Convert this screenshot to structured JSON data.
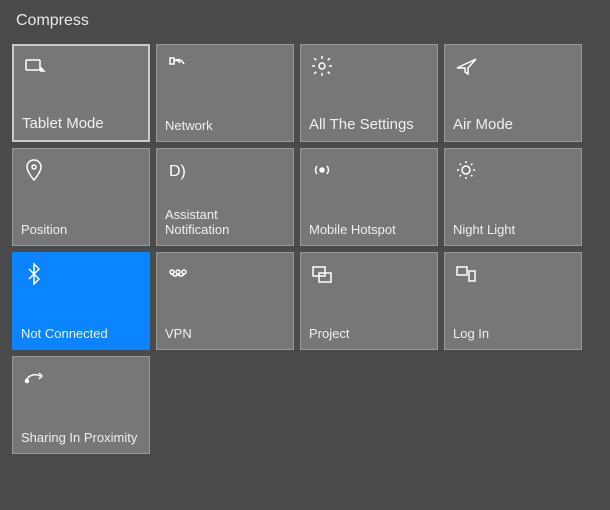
{
  "header": "Compress",
  "tiles": [
    {
      "icon": "tablet-mode-icon",
      "label": "Tablet Mode",
      "sublabel": "",
      "active": false
    },
    {
      "icon": "wifi-icon",
      "label": "Network",
      "sublabel": "",
      "active": false
    },
    {
      "icon": "gear-icon",
      "label": "All The Settings",
      "sublabel": "",
      "active": false
    },
    {
      "icon": "airplane-icon",
      "label": "Air Mode",
      "sublabel": "",
      "active": false
    },
    {
      "icon": "location-icon",
      "label": "Position",
      "sublabel": "",
      "active": false
    },
    {
      "icon": "moon-icon",
      "label": "Assistant Notification",
      "sublabel": "",
      "active": false
    },
    {
      "icon": "hotspot-icon",
      "label": "Mobile Hotspot",
      "sublabel": "",
      "active": false
    },
    {
      "icon": "sun-icon",
      "label": "Night Light",
      "sublabel": "",
      "active": false
    },
    {
      "icon": "bluetooth-icon",
      "label": "Not Connected",
      "sublabel": "",
      "active": true
    },
    {
      "icon": "vpn-icon",
      "label": "VPN",
      "sublabel": "",
      "active": false
    },
    {
      "icon": "project-icon",
      "label": "Project",
      "sublabel": "",
      "active": false
    },
    {
      "icon": "connect-icon",
      "label": "Log In",
      "sublabel": "",
      "active": false
    },
    {
      "icon": "sharing-icon",
      "label": "Sharing In Proximity",
      "sublabel": "",
      "active": false
    }
  ]
}
